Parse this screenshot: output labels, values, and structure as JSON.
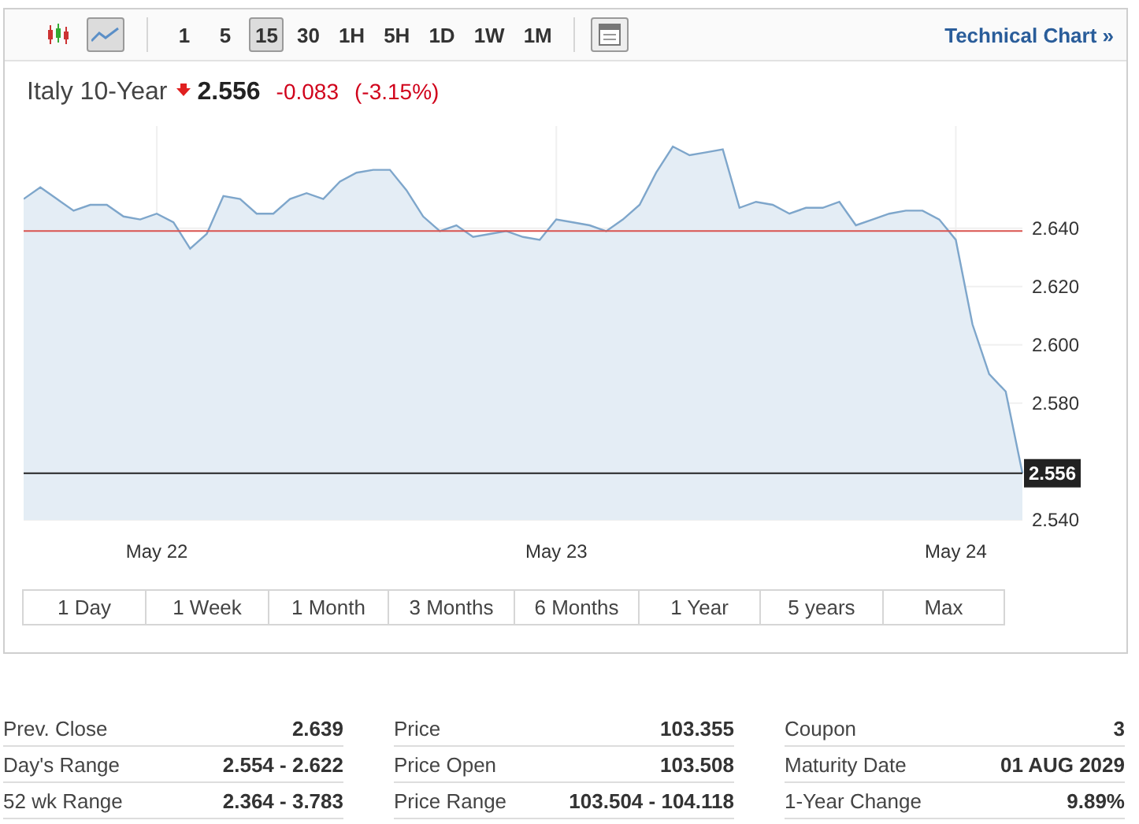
{
  "toolbar": {
    "chart_types": [
      {
        "kind": "candles",
        "selected": false
      },
      {
        "kind": "line",
        "selected": true
      }
    ],
    "intervals": [
      {
        "label": "1",
        "selected": false
      },
      {
        "label": "5",
        "selected": false
      },
      {
        "label": "15",
        "selected": true
      },
      {
        "label": "30",
        "selected": false
      },
      {
        "label": "1H",
        "selected": false
      },
      {
        "label": "5H",
        "selected": false
      },
      {
        "label": "1D",
        "selected": false
      },
      {
        "label": "1W",
        "selected": false
      },
      {
        "label": "1M",
        "selected": false
      }
    ],
    "link": "Technical Chart »"
  },
  "quote": {
    "name": "Italy 10-Year",
    "down": true,
    "price": "2.556",
    "change": "-0.083",
    "change_percent": "(-3.15%)"
  },
  "chart": {
    "chart_data": {
      "type": "area",
      "ylim": [
        2.54,
        2.675
      ],
      "categories": [
        null,
        null,
        null,
        null,
        null,
        null,
        null,
        null,
        "May 22",
        null,
        null,
        null,
        null,
        null,
        null,
        null,
        null,
        null,
        null,
        null,
        null,
        null,
        null,
        null,
        null,
        null,
        null,
        null,
        null,
        null,
        null,
        null,
        "May 23",
        null,
        null,
        null,
        null,
        null,
        null,
        null,
        null,
        null,
        null,
        null,
        null,
        null,
        null,
        null,
        null,
        null,
        null,
        null,
        null,
        null,
        null,
        null,
        "May 24",
        null,
        null,
        null,
        null
      ],
      "series": [
        {
          "color": "#7ea6cb",
          "values": [
            2.65,
            2.654,
            2.65,
            2.646,
            2.648,
            2.648,
            2.644,
            2.643,
            2.645,
            2.642,
            2.633,
            2.638,
            2.651,
            2.65,
            2.645,
            2.645,
            2.65,
            2.652,
            2.65,
            2.656,
            2.659,
            2.66,
            2.66,
            2.653,
            2.644,
            2.639,
            2.641,
            2.637,
            2.638,
            2.639,
            2.637,
            2.636,
            2.643,
            2.642,
            2.641,
            2.639,
            2.643,
            2.648,
            2.659,
            2.668,
            2.665,
            2.666,
            2.667,
            2.647,
            2.649,
            2.648,
            2.645,
            2.647,
            2.647,
            2.649,
            2.641,
            2.643,
            2.645,
            2.646,
            2.646,
            2.643,
            2.636,
            2.607,
            2.59,
            2.584,
            2.556
          ]
        }
      ],
      "yticks": [
        {
          "value": 2.54,
          "label": "2.540"
        },
        {
          "value": 2.58,
          "label": "2.580"
        },
        {
          "value": 2.6,
          "label": "2.600"
        },
        {
          "value": 2.62,
          "label": "2.620"
        },
        {
          "value": 2.64,
          "label": "2.640"
        }
      ],
      "grid": true,
      "ref_lines": [
        {
          "axis": "y",
          "value": 2.639,
          "color": "#d9534f"
        },
        {
          "axis": "y",
          "value": 2.556,
          "color": "#222222",
          "label": "2.556"
        }
      ]
    }
  },
  "ranges": [
    {
      "label": "1 Day"
    },
    {
      "label": "1 Week"
    },
    {
      "label": "1 Month"
    },
    {
      "label": "3 Months"
    },
    {
      "label": "6 Months"
    },
    {
      "label": "1 Year"
    },
    {
      "label": "5 years"
    },
    {
      "label": "Max"
    }
  ],
  "stats": [
    [
      {
        "label": "Prev. Close",
        "value": "2.639"
      },
      {
        "label": "Day's Range",
        "value": "2.554 - 2.622"
      },
      {
        "label": "52 wk Range",
        "value": "2.364 - 3.783"
      }
    ],
    [
      {
        "label": "Price",
        "value": "103.355"
      },
      {
        "label": "Price Open",
        "value": "103.508"
      },
      {
        "label": "Price Range",
        "value": "103.504 - 104.118"
      }
    ],
    [
      {
        "label": "Coupon",
        "value": "3"
      },
      {
        "label": "Maturity Date",
        "value": "01 AUG 2029"
      },
      {
        "label": "1-Year Change",
        "value": "9.89%"
      }
    ]
  ]
}
